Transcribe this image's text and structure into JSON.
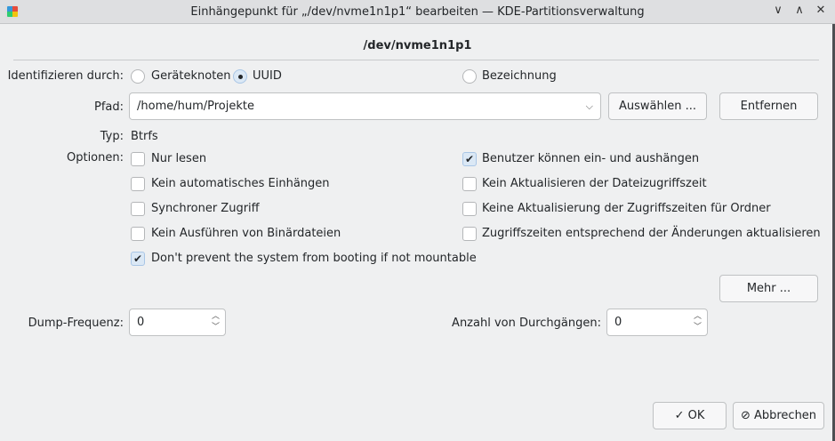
{
  "window": {
    "title": "Einhängepunkt für „/dev/nvme1n1p1“ bearbeiten — KDE-Partitionsverwaltung",
    "min": "∨",
    "max": "∧",
    "close": "✕"
  },
  "device": "/dev/nvme1n1p1",
  "identify": {
    "label": "Identifizieren durch:",
    "options": [
      {
        "label": "Geräteknoten",
        "selected": false
      },
      {
        "label": "UUID",
        "selected": true
      },
      {
        "label": "Bezeichnung",
        "selected": false
      }
    ]
  },
  "path": {
    "label": "Pfad:",
    "value": "/home/hum/Projekte",
    "choose": "Auswählen ...",
    "remove": "Entfernen"
  },
  "type": {
    "label": "Typ:",
    "value": "Btrfs"
  },
  "options": {
    "label": "Optionen:",
    "items": [
      {
        "label": "Nur lesen",
        "checked": false
      },
      {
        "label": "Benutzer können ein- und aushängen",
        "checked": true
      },
      {
        "label": "Kein automatisches Einhängen",
        "checked": false
      },
      {
        "label": "Kein Aktualisieren der Dateizugriffszeit",
        "checked": false
      },
      {
        "label": "Synchroner Zugriff",
        "checked": false
      },
      {
        "label": "Keine Aktualisierung der Zugriffszeiten für Ordner",
        "checked": false
      },
      {
        "label": "Kein Ausführen von Binärdateien",
        "checked": false
      },
      {
        "label": "Zugriffszeiten entsprechend der Änderungen aktualisieren",
        "checked": false
      },
      {
        "label": "Don't prevent the system from booting if not mountable",
        "checked": true
      }
    ],
    "more": "Mehr ..."
  },
  "dump": {
    "label": "Dump-Frequenz:",
    "value": "0"
  },
  "passes": {
    "label": "Anzahl von Durchgängen:",
    "value": "0"
  },
  "buttons": {
    "ok": "OK",
    "cancel": "Abbrechen"
  }
}
